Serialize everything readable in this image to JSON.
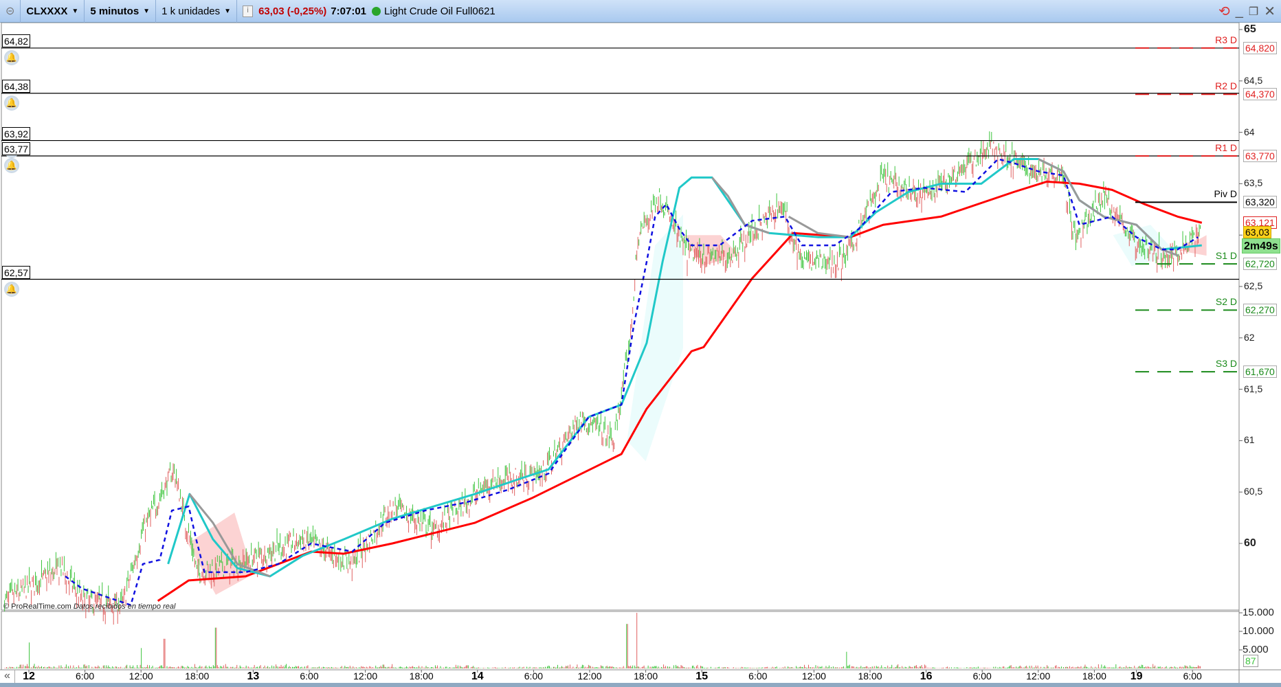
{
  "toolbar": {
    "instrument": "CLXXXX",
    "timeframe": "5 minutos",
    "units": "1 k unidades",
    "price": "63,03 (-0,25%)",
    "clock": "7:07:01",
    "instrument_name": "Light Crude Oil Full0621"
  },
  "alerts": [
    {
      "label": "64,82",
      "price": 64.82
    },
    {
      "label": "64,38",
      "price": 64.38
    },
    {
      "label": "63,92",
      "price": 63.92
    },
    {
      "label": "63,77",
      "price": 63.77
    },
    {
      "label": "62,57",
      "price": 62.57
    }
  ],
  "pivots": [
    {
      "name": "R3 D",
      "value": "64,820",
      "price": 64.82,
      "color": "#e02020",
      "style": "dashed"
    },
    {
      "name": "R2 D",
      "value": "64,370",
      "price": 64.37,
      "color": "#e02020",
      "style": "dashed"
    },
    {
      "name": "R1 D",
      "value": "63,770",
      "price": 63.77,
      "color": "#e02020",
      "style": "dashed"
    },
    {
      "name": "Piv D",
      "value": "63,320",
      "price": 63.32,
      "color": "#000000",
      "style": "solid"
    },
    {
      "name": "S1 D",
      "value": "62,720",
      "price": 62.72,
      "color": "#1a8a1a",
      "style": "dashed"
    },
    {
      "name": "S2 D",
      "value": "62,270",
      "price": 62.27,
      "color": "#1a8a1a",
      "style": "dashed"
    },
    {
      "name": "S3 D",
      "value": "61,670",
      "price": 61.67,
      "color": "#1a8a1a",
      "style": "dashed"
    }
  ],
  "markers": {
    "ma_value": "63,121",
    "last_price": "63,03",
    "countdown": "2m49s"
  },
  "watermark": {
    "brand": "© ProRealTime.com",
    "note": "Datos recibidos en tiempo real"
  },
  "chart_data": {
    "type": "candlestick",
    "title": "CLXXXX 5 minutos",
    "y_ticks": [
      {
        "v": 65,
        "t": "65",
        "b": true
      },
      {
        "v": 64.5,
        "t": "64,5"
      },
      {
        "v": 64,
        "t": "64"
      },
      {
        "v": 63.5,
        "t": "63,5"
      },
      {
        "v": 63,
        "t": "63"
      },
      {
        "v": 62.5,
        "t": "62,5"
      },
      {
        "v": 62,
        "t": "62"
      },
      {
        "v": 61.5,
        "t": "61,5"
      },
      {
        "v": 61,
        "t": "61"
      },
      {
        "v": 60.5,
        "t": "60,5"
      },
      {
        "v": 60,
        "t": "60",
        "b": true
      }
    ],
    "ylim": [
      59.36,
      65.05
    ],
    "x_ticks": [
      {
        "h": 0,
        "t": "12",
        "b": true
      },
      {
        "h": 6,
        "t": "6:00"
      },
      {
        "h": 12,
        "t": "12:00"
      },
      {
        "h": 18,
        "t": "18:00"
      },
      {
        "h": 24,
        "t": "13",
        "b": true
      },
      {
        "h": 30,
        "t": "6:00"
      },
      {
        "h": 36,
        "t": "12:00"
      },
      {
        "h": 42,
        "t": "18:00"
      },
      {
        "h": 48,
        "t": "14",
        "b": true
      },
      {
        "h": 54,
        "t": "6:00"
      },
      {
        "h": 60,
        "t": "12:00"
      },
      {
        "h": 66,
        "t": "18:00"
      },
      {
        "h": 72,
        "t": "15",
        "b": true
      },
      {
        "h": 78,
        "t": "6:00"
      },
      {
        "h": 84,
        "t": "12:00"
      },
      {
        "h": 90,
        "t": "18:00"
      },
      {
        "h": 96,
        "t": "16",
        "b": true
      },
      {
        "h": 102,
        "t": "6:00"
      },
      {
        "h": 108,
        "t": "12:00"
      },
      {
        "h": 114,
        "t": "18:00"
      },
      {
        "h": 118.5,
        "t": "19",
        "b": true
      },
      {
        "h": 124.5,
        "t": "6:00"
      }
    ],
    "price_path": [
      [
        -2.6,
        59.44
      ],
      [
        3.5,
        59.76
      ],
      [
        5.7,
        59.44
      ],
      [
        10,
        59.4
      ],
      [
        12.2,
        60.12
      ],
      [
        15.5,
        60.72
      ],
      [
        18,
        59.72
      ],
      [
        22.3,
        59.8
      ],
      [
        29.3,
        60.04
      ],
      [
        34.6,
        59.8
      ],
      [
        38.9,
        60.36
      ],
      [
        43.3,
        60.12
      ],
      [
        49.4,
        60.6
      ],
      [
        54.9,
        60.68
      ],
      [
        59.1,
        61.23
      ],
      [
        62.6,
        60.99
      ],
      [
        64.3,
        61.95
      ],
      [
        65.2,
        62.98
      ],
      [
        67.4,
        63.38
      ],
      [
        70.4,
        62.82
      ],
      [
        74.8,
        62.78
      ],
      [
        80.5,
        63.3
      ],
      [
        82.7,
        62.74
      ],
      [
        87.1,
        62.74
      ],
      [
        91.4,
        63.54
      ],
      [
        95.8,
        63.38
      ],
      [
        103.1,
        63.86
      ],
      [
        107.2,
        63.62
      ],
      [
        110.6,
        63.62
      ],
      [
        112,
        62.94
      ],
      [
        115,
        63.38
      ],
      [
        118.6,
        62.9
      ],
      [
        122,
        62.78
      ],
      [
        125.4,
        63.02
      ]
    ],
    "series": [
      {
        "name": "MA red",
        "color": "#ff0000",
        "width": 3,
        "points": [
          [
            13.8,
            59.44
          ],
          [
            17.1,
            59.64
          ],
          [
            23.2,
            59.68
          ],
          [
            30.2,
            59.92
          ],
          [
            33.7,
            59.9
          ],
          [
            38.9,
            60
          ],
          [
            47.7,
            60.2
          ],
          [
            53.8,
            60.44
          ],
          [
            63.4,
            60.87
          ],
          [
            66.1,
            61.31
          ],
          [
            70.9,
            61.87
          ],
          [
            72.2,
            61.91
          ],
          [
            77.4,
            62.58
          ],
          [
            81.8,
            63.02
          ],
          [
            87.9,
            62.98
          ],
          [
            91.4,
            63.1
          ],
          [
            97.6,
            63.18
          ],
          [
            105.4,
            63.42
          ],
          [
            108.9,
            63.52
          ],
          [
            112.4,
            63.5
          ],
          [
            115.9,
            63.44
          ],
          [
            119.4,
            63.3
          ],
          [
            122.9,
            63.18
          ],
          [
            125.5,
            63.12
          ]
        ]
      },
      {
        "name": "MA cyan",
        "color": "#20c8c8",
        "width": 3,
        "points": [
          [
            14.9,
            59.8
          ],
          [
            17.2,
            60.48
          ],
          [
            19.7,
            60.04
          ],
          [
            22.3,
            59.76
          ],
          [
            25.8,
            59.68
          ],
          [
            29.3,
            59.88
          ],
          [
            33.7,
            60.04
          ],
          [
            38.9,
            60.24
          ],
          [
            43.3,
            60.36
          ],
          [
            47.7,
            60.48
          ],
          [
            52.9,
            60.64
          ],
          [
            55.6,
            60.72
          ],
          [
            59.9,
            61.23
          ],
          [
            63.4,
            61.35
          ],
          [
            66.1,
            61.95
          ],
          [
            67.8,
            62.74
          ],
          [
            69.6,
            63.46
          ],
          [
            70.9,
            63.56
          ],
          [
            73.1,
            63.56
          ],
          [
            76.6,
            63.1
          ],
          [
            79.2,
            63.02
          ],
          [
            84.4,
            62.98
          ],
          [
            87.9,
            62.98
          ],
          [
            90.6,
            63.22
          ],
          [
            94.1,
            63.42
          ],
          [
            97.6,
            63.5
          ],
          [
            101.9,
            63.5
          ],
          [
            105.4,
            63.74
          ],
          [
            108,
            63.74
          ],
          [
            110.7,
            63.62
          ],
          [
            112.4,
            63.34
          ],
          [
            115,
            63.18
          ],
          [
            118.5,
            63.1
          ],
          [
            121.2,
            62.86
          ],
          [
            125.5,
            62.9
          ]
        ]
      },
      {
        "name": "MA gray",
        "color": "#999999",
        "width": 3,
        "points": [
          [
            17.2,
            60.48
          ],
          [
            19.7,
            60.2
          ],
          [
            22.3,
            59.8
          ],
          [
            25.8,
            59.68
          ],
          null,
          [
            73.1,
            63.56
          ],
          [
            74.8,
            63.38
          ],
          [
            76.6,
            63.1
          ],
          [
            79.2,
            63.02
          ],
          null,
          [
            81.3,
            63.18
          ],
          [
            84.4,
            63.02
          ],
          [
            87.9,
            62.98
          ],
          null,
          [
            108,
            63.74
          ],
          [
            110.7,
            63.62
          ],
          [
            112.4,
            63.34
          ],
          [
            115,
            63.18
          ],
          [
            118.5,
            63.1
          ],
          [
            121.2,
            62.86
          ],
          [
            123,
            62.8
          ]
        ]
      },
      {
        "name": "Dashed blue",
        "color": "#1010e0",
        "width": 2.5,
        "dashed": true,
        "points": [
          [
            3.9,
            59.68
          ],
          [
            5.7,
            59.56
          ],
          [
            10.9,
            59.4
          ],
          [
            12.2,
            59.8
          ],
          [
            14,
            59.84
          ],
          [
            15.3,
            60.32
          ],
          [
            17.1,
            60.36
          ],
          [
            17.9,
            60.04
          ],
          [
            18.8,
            59.72
          ],
          [
            23.2,
            59.72
          ],
          [
            26.7,
            59.8
          ],
          [
            30.2,
            60
          ],
          [
            34.6,
            59.92
          ],
          [
            38.1,
            60.2
          ],
          [
            42.4,
            60.32
          ],
          [
            46.8,
            60.4
          ],
          [
            51.2,
            60.52
          ],
          [
            55.6,
            60.68
          ],
          [
            59.9,
            61.23
          ],
          [
            63.4,
            61.35
          ],
          [
            64.7,
            62.11
          ],
          [
            66.1,
            62.74
          ],
          [
            67,
            63.18
          ],
          [
            68.2,
            63.3
          ],
          [
            69.6,
            63.06
          ],
          [
            70.9,
            62.9
          ],
          [
            73.9,
            62.9
          ],
          [
            77.4,
            63.14
          ],
          [
            80.9,
            63.18
          ],
          [
            82.7,
            62.9
          ],
          [
            86.2,
            62.9
          ],
          [
            88.8,
            63.06
          ],
          [
            92.3,
            63.42
          ],
          [
            95.8,
            63.46
          ],
          [
            100.2,
            63.42
          ],
          [
            103.7,
            63.74
          ],
          [
            105.4,
            63.7
          ],
          [
            108,
            63.62
          ],
          [
            110.7,
            63.58
          ],
          [
            112.4,
            63.1
          ],
          [
            115.9,
            63.18
          ],
          [
            118.5,
            62.98
          ],
          [
            121.2,
            62.86
          ],
          [
            122.9,
            62.86
          ],
          [
            125.1,
            62.98
          ]
        ]
      }
    ],
    "volume": {
      "y_ticks": [
        {
          "v": 15000,
          "t": "15.000"
        },
        {
          "v": 10000,
          "t": "10.000"
        },
        {
          "v": 5000,
          "t": "5.000"
        }
      ],
      "last": "87",
      "spikes": [
        [
          0,
          7000
        ],
        [
          12,
          5500
        ],
        [
          14.5,
          8000
        ],
        [
          20,
          11000
        ],
        [
          64,
          12000
        ],
        [
          65,
          15000
        ],
        [
          87.5,
          4500
        ]
      ]
    }
  }
}
